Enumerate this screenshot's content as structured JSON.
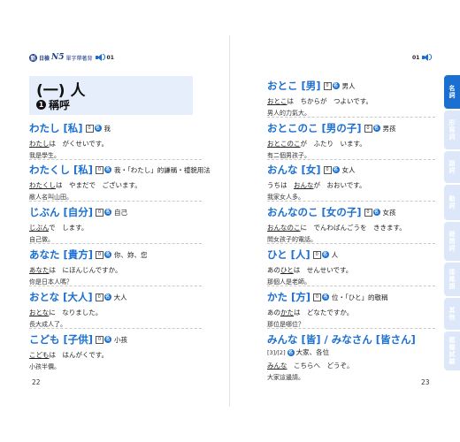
{
  "header": {
    "logo_char": "新",
    "brand": "日檢",
    "level": "N5",
    "subtitle": "單字帶著背",
    "track_left": "01",
    "track_right": "01"
  },
  "section": {
    "title": "(一) 人",
    "subtitle_num": "1",
    "subtitle": "稱呼"
  },
  "left_entries": [
    {
      "head": "わたし [私]",
      "meaning": "我",
      "example": "わたしは　がくせいです。",
      "underline": "わたし",
      "rest": "は　がくせいです。",
      "translation": "我是學生。"
    },
    {
      "head": "わたくし [私]",
      "meaning": "我・「わたし」的謙稱・禮貌用法",
      "example": "わたくしは　やまだで　ございます。",
      "underline": "わたくし",
      "rest": "は　やまだで　ございます。",
      "translation": "敝人名叫山田。"
    },
    {
      "head": "じぶん [自分]",
      "meaning": "自己",
      "example": "じぶんで　します。",
      "underline": "じぶん",
      "rest": "で　します。",
      "translation": "自己做。"
    },
    {
      "head": "あなた [貴方]",
      "meaning": "你、妳、您",
      "example": "あなたは　にほんじんですか。",
      "underline": "あなた",
      "rest": "は　にほんじんですか。",
      "translation": "你是日本人嗎？"
    },
    {
      "head": "おとな [大人]",
      "meaning": "大人",
      "example": "おとなに　なりました。",
      "underline": "おとな",
      "rest": "に　なりました。",
      "translation": "長大成人了。"
    },
    {
      "head": "こども [子供]",
      "meaning": "小孩",
      "example": "こどもは　はんがくです。",
      "underline": "こども",
      "rest": "は　はんがくです。",
      "translation": "小孩半價。"
    }
  ],
  "right_entries": [
    {
      "head": "おとこ [男]",
      "meaning": "男人",
      "pre": "",
      "underline": "おとこ",
      "rest": "は　ちからが　つよいです。",
      "translation": "男人的力氣大。"
    },
    {
      "head": "おとこのこ [男の子]",
      "meaning": "男孩",
      "pre": "",
      "underline": "おとこのこ",
      "rest": "が　ふたり　います。",
      "translation": "有二個男孩子。"
    },
    {
      "head": "おんな [女]",
      "meaning": "女人",
      "pre": "うちは　",
      "underline": "おんな",
      "rest": "が　おおいです。",
      "translation": "我家女人多。"
    },
    {
      "head": "おんなのこ [女の子]",
      "meaning": "女孩",
      "pre": "",
      "underline": "おんなのこ",
      "rest": "に　でんわばんごうを　ききます。",
      "translation": "問女孩子的電話。"
    },
    {
      "head": "ひと [人]",
      "meaning": "人",
      "pre": "あの",
      "underline": "ひと",
      "rest": "は　せんせいです。",
      "translation": "那個人是老師。"
    },
    {
      "head": "かた [方]",
      "meaning": "位・「ひと」的敬稱",
      "pre": "あの",
      "underline": "かた",
      "rest": "は　どなたですか。",
      "translation": "那位是哪位？"
    },
    {
      "head": "みんな [皆] / みなさん [皆さん]",
      "meaning": "大家、各位",
      "pre": "",
      "underline": "みんな",
      "rest": "　こちらへ　どうぞ。",
      "translation": "大家這邊請。",
      "extra_prefix": "[3]/[2]"
    }
  ],
  "badges": {
    "box_num": "0",
    "dot_char": "名"
  },
  "page_numbers": {
    "left": "22",
    "right": "23"
  },
  "tabs": [
    {
      "label": "名詞",
      "active": true
    },
    {
      "label": "形容詞",
      "active": false
    },
    {
      "label": "副詞",
      "active": false
    },
    {
      "label": "動詞",
      "active": false
    },
    {
      "label": "疑問詞",
      "active": false
    },
    {
      "label": "接尾語",
      "active": false
    },
    {
      "label": "其他",
      "active": false
    },
    {
      "label": "模擬試驗",
      "active": false
    }
  ],
  "colors": {
    "accent": "#1a6fd0",
    "tab_inactive": "#dce8fa",
    "title_bg": "#e6eefb"
  }
}
